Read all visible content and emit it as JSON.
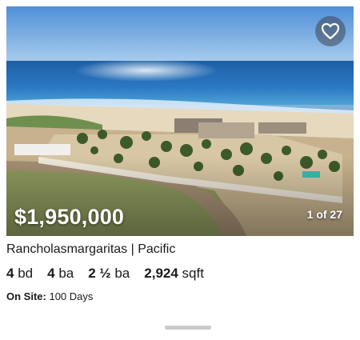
{
  "listing": {
    "price": "$1,950,000",
    "photo_counter": "1 of 27",
    "location": "Rancholasmargaritas | Pacific",
    "beds": {
      "value": "4",
      "unit": "bd"
    },
    "baths": {
      "value": "4",
      "unit": "ba"
    },
    "half_baths": {
      "value": "2 ½",
      "unit": "ba"
    },
    "area": {
      "value": "2,924",
      "unit": "sqft"
    },
    "on_site": {
      "label": "On Site:",
      "value": "100 Days"
    }
  },
  "icons": {
    "favorite": "heart-outline-icon"
  },
  "colors": {
    "overlay_text": "#ffffff",
    "favorite_bg": "#3c4655",
    "body_text": "#1a1a1a",
    "handle": "#c9c9c9"
  }
}
